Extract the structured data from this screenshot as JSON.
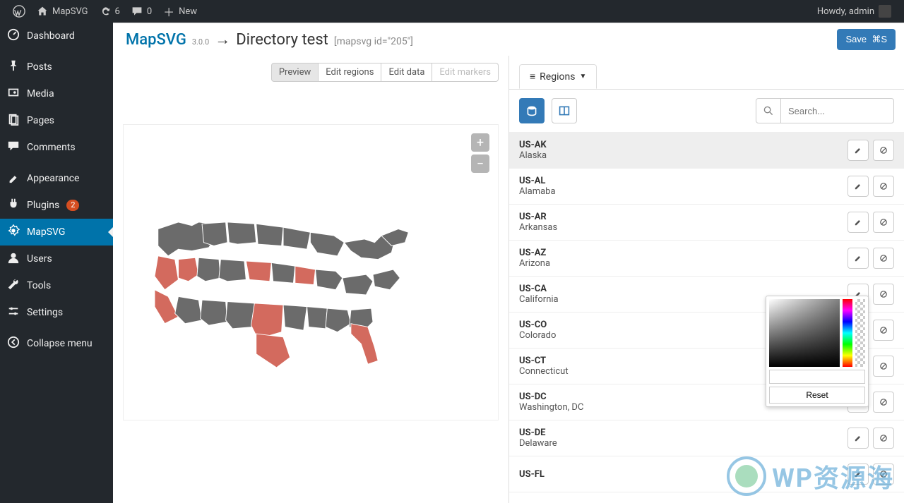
{
  "adminbar": {
    "site": "MapSVG",
    "updates": "6",
    "comments": "0",
    "new": "New",
    "howdy": "Howdy, admin"
  },
  "sidebar": {
    "items": [
      {
        "label": "Dashboard",
        "icon": "dash"
      },
      {
        "label": "Posts",
        "icon": "pin"
      },
      {
        "label": "Media",
        "icon": "media"
      },
      {
        "label": "Pages",
        "icon": "page"
      },
      {
        "label": "Comments",
        "icon": "comment"
      },
      {
        "label": "Appearance",
        "icon": "brush"
      },
      {
        "label": "Plugins",
        "icon": "plug",
        "badge": "2"
      },
      {
        "label": "MapSVG",
        "icon": "gear",
        "active": true
      },
      {
        "label": "Users",
        "icon": "user"
      },
      {
        "label": "Tools",
        "icon": "wrench"
      },
      {
        "label": "Settings",
        "icon": "sliders"
      },
      {
        "label": "Collapse menu",
        "icon": "collapse"
      }
    ]
  },
  "crumb": {
    "root": "MapSVG",
    "version": "3.0.0",
    "arrow": "→",
    "title": "Directory test",
    "shortcode": "[mapsvg id=\"205\"]"
  },
  "save": {
    "label": "Save",
    "kbd": "⌘S"
  },
  "maptabs": {
    "preview": "Preview",
    "editregions": "Edit regions",
    "editdata": "Edit data",
    "editmarkers": "Edit markers"
  },
  "rightTab": "Regions",
  "search": {
    "placeholder": "Search..."
  },
  "picker": {
    "reset": "Reset"
  },
  "regions": [
    {
      "code": "US-AK",
      "name": "Alaska",
      "sel": true
    },
    {
      "code": "US-AL",
      "name": "Alamaba"
    },
    {
      "code": "US-AR",
      "name": "Arkansas"
    },
    {
      "code": "US-AZ",
      "name": "Arizona"
    },
    {
      "code": "US-CA",
      "name": "California"
    },
    {
      "code": "US-CO",
      "name": "Colorado"
    },
    {
      "code": "US-CT",
      "name": "Connecticut"
    },
    {
      "code": "US-DC",
      "name": "Washington, DC"
    },
    {
      "code": "US-DE",
      "name": "Delaware"
    },
    {
      "code": "US-FL",
      "name": ""
    }
  ],
  "watermark": "WP资源海"
}
